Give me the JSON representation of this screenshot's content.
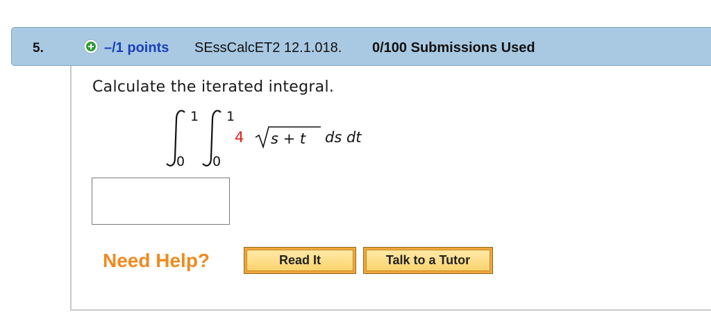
{
  "question": {
    "number": "5.",
    "points": "–/1 points",
    "code": "SEssCalcET2 12.1.018.",
    "submissions": "0/100 Submissions Used"
  },
  "problem": {
    "instruction": "Calculate the iterated integral.",
    "outer_lower": "0",
    "outer_upper": "1",
    "inner_lower": "0",
    "inner_upper": "1",
    "coefficient": "4",
    "radicand": "s + t",
    "differentials": "ds dt"
  },
  "answer": {
    "value": ""
  },
  "help": {
    "label": "Need Help?",
    "read_it": "Read It",
    "tutor": "Talk to a Tutor"
  },
  "colors": {
    "header_bg": "#a9c9e3",
    "points_blue": "#1a3fb8",
    "coefficient_red": "#e0201b",
    "help_orange": "#f08a1e",
    "button_orange": "#f3a53c"
  },
  "icons": {
    "expand": "plus-circle-icon"
  }
}
